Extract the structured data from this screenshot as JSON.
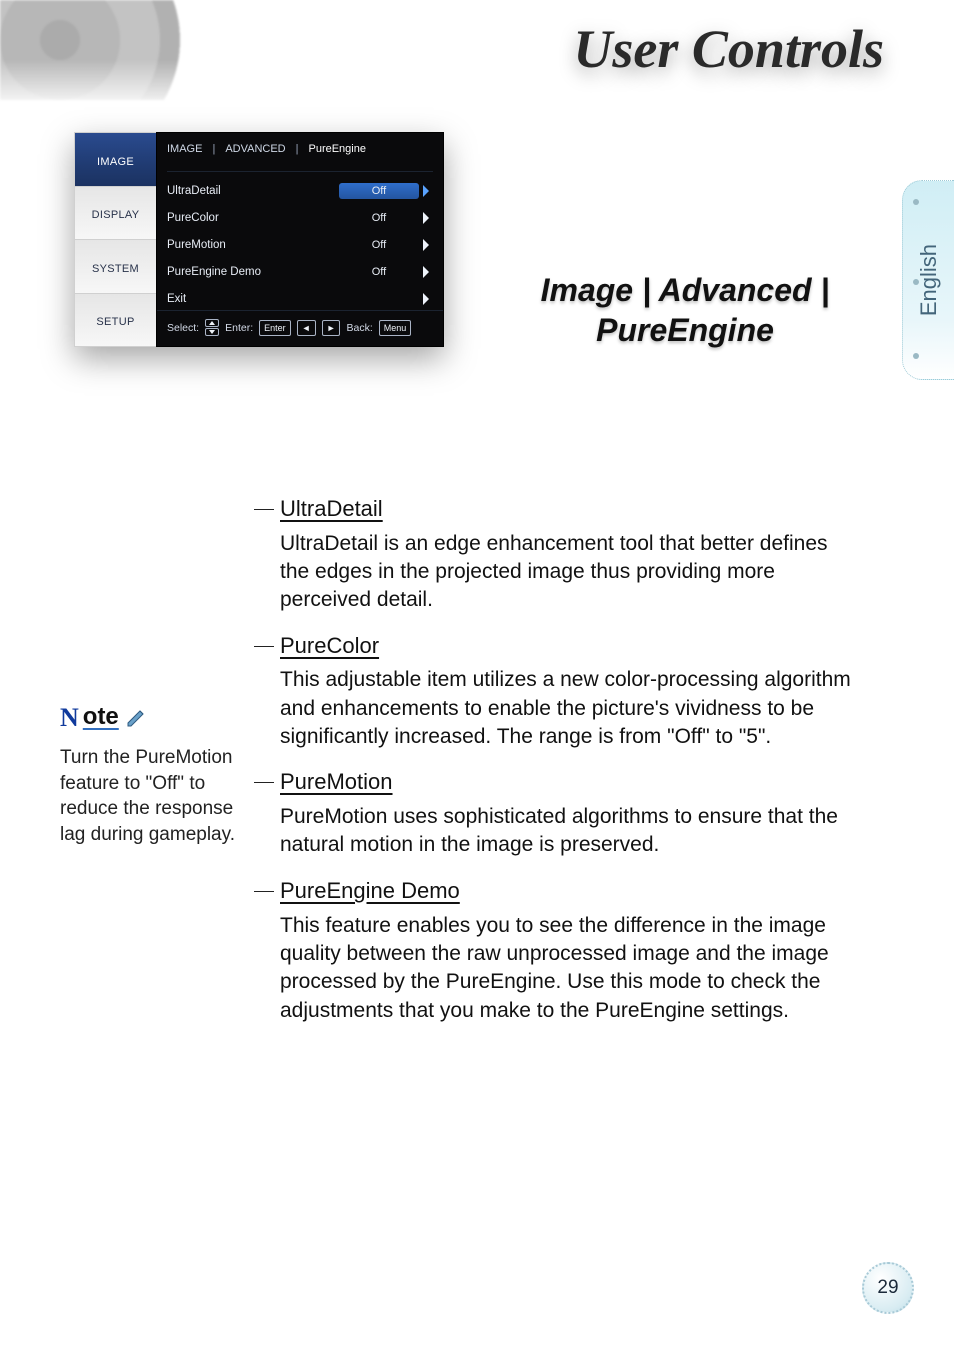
{
  "page_title": "User Controls",
  "language_tab": "English",
  "page_number": "29",
  "osd": {
    "left_tabs": [
      {
        "label": "IMAGE",
        "active": true
      },
      {
        "label": "DISPLAY",
        "active": false
      },
      {
        "label": "SYSTEM",
        "active": false
      },
      {
        "label": "SETUP",
        "active": false
      }
    ],
    "breadcrumb": {
      "a": "IMAGE",
      "b": "ADVANCED",
      "c": "PureEngine"
    },
    "rows": [
      {
        "label": "UltraDetail",
        "value": "Off",
        "active": true
      },
      {
        "label": "PureColor",
        "value": "Off",
        "active": false
      },
      {
        "label": "PureMotion",
        "value": "Off",
        "active": false
      },
      {
        "label": "PureEngine Demo",
        "value": "Off",
        "active": false
      },
      {
        "label": "Exit",
        "value": "",
        "active": false
      }
    ],
    "footer": {
      "select_label": "Select:",
      "enter_label": "Enter:",
      "enter_key": "Enter",
      "back_label": "Back:",
      "back_key": "Menu"
    }
  },
  "section_title": "Image | Advanced | PureEngine",
  "note": {
    "badge_initial": "N",
    "badge_rest": "ote",
    "text": "Turn the PureMotion feature to \"Off\" to reduce the response lag during gameplay."
  },
  "sections": [
    {
      "heading": "UltraDetail",
      "body": "UltraDetail is an edge enhancement tool that better defines the edges in the projected image thus providing more perceived detail."
    },
    {
      "heading": "PureColor",
      "body": "This adjustable item utilizes a new color-processing algorithm and enhancements to enable the picture's vividness to be significantly increased. The range is from \"Off\" to \"5\"."
    },
    {
      "heading": "PureMotion",
      "body": "PureMotion uses sophisticated algorithms to ensure that the natural motion in the image is preserved."
    },
    {
      "heading": "PureEngine Demo",
      "body": "This feature enables you to see the difference in the image quality between the raw unprocessed image and the image processed by the PureEngine. Use this mode to check the adjustments that you make to the PureEngine settings."
    }
  ]
}
